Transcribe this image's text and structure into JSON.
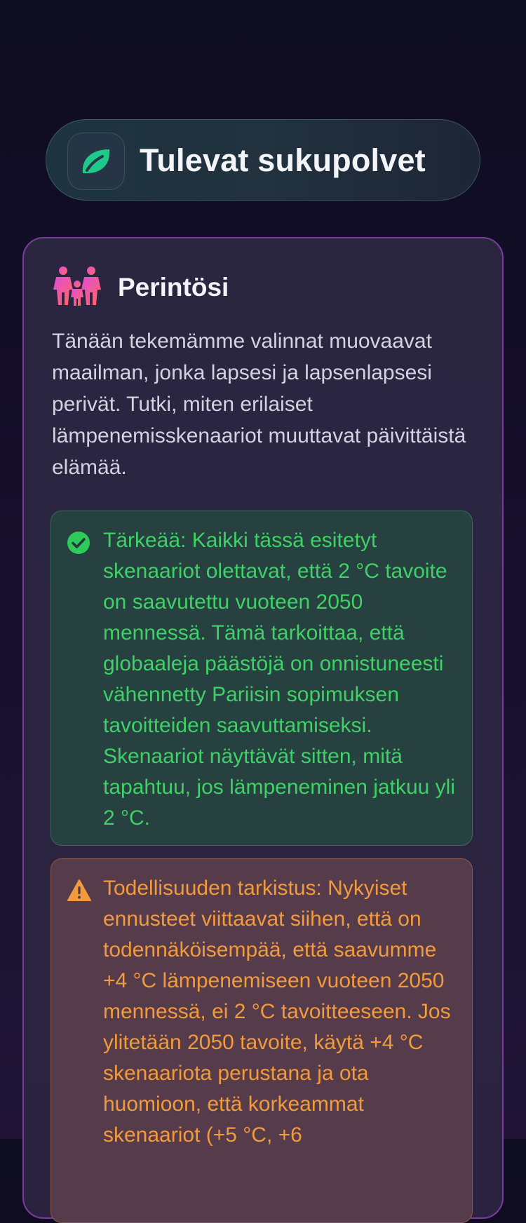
{
  "header": {
    "title": "Tulevat sukupolvet",
    "app_icon": "leaf-icon"
  },
  "legacy": {
    "icon": "family-icon",
    "title": "Perintösi",
    "intro": "Tänään tekemämme valinnat muovaavat maailman, jonka lapsesi ja lapsenlapsesi perivät. Tutki, miten erilaiset lämpenemisskenaariot muuttavat päivittäistä elämää.",
    "important": {
      "icon": "check-circle-icon",
      "text": "Tärkeää: Kaikki tässä esitetyt skenaariot olettavat, että 2 °C tavoite on saavutettu vuoteen 2050 mennessä. Tämä tarkoittaa, että globaaleja päästöjä on onnistuneesti vähennetty Pariisin sopimuksen tavoitteiden saavuttamiseksi. Skenaariot näyttävät sitten, mitä tapahtuu, jos lämpeneminen jatkuu yli 2 °C."
    },
    "reality_check": {
      "icon": "warning-icon",
      "text": "Todellisuuden tarkistus: Nykyiset ennusteet viittaavat siihen, että on todennäköisempää, että saavumme +4 °C lämpenemiseen vuoteen 2050 mennessä, ei 2 °C tavoitteeseen. Jos ylitetään 2050 tavoite, käytä +4 °C skenaariota perustana ja ota huomioon, että korkeammat skenaariot (+5 °C, +6"
    }
  },
  "colors": {
    "accent_green": "#3fd166",
    "accent_orange": "#f29a3c",
    "card_border": "#7a3c9a"
  }
}
